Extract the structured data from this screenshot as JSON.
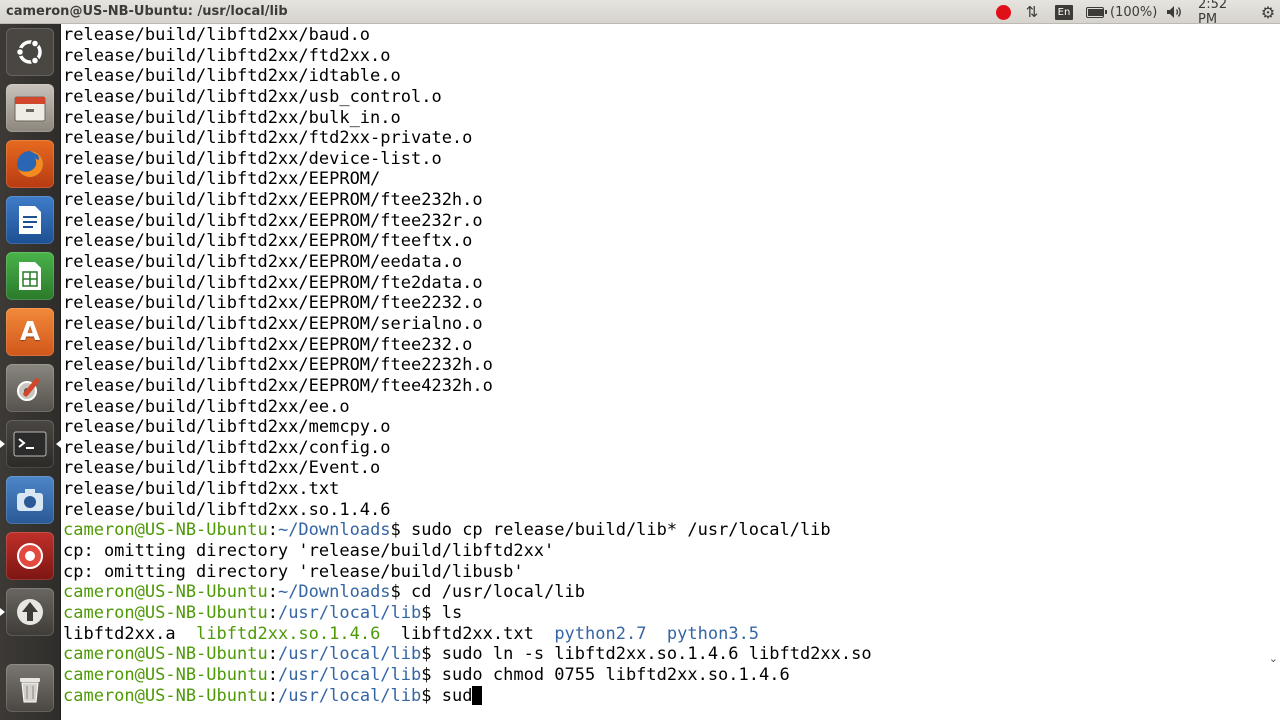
{
  "panel": {
    "window_title": "cameron@US-NB-Ubuntu: /usr/local/lib",
    "keyboard_layout": "En",
    "battery": {
      "text": "(100%)",
      "level": 1.0
    },
    "clock": "2:52 PM",
    "recording_color": "#e0101a",
    "icons": {
      "network": "network-updown-icon",
      "sound": "speaker-icon",
      "session": "gear-icon"
    }
  },
  "launcher": {
    "items": [
      {
        "name": "dash-home",
        "icon": "ubuntu-logo-icon",
        "active": false
      },
      {
        "name": "files",
        "icon": "file-cabinet-icon",
        "active": false
      },
      {
        "name": "firefox",
        "icon": "firefox-icon",
        "active": false
      },
      {
        "name": "writer",
        "icon": "libreoffice-writer-icon",
        "active": false
      },
      {
        "name": "calc",
        "icon": "libreoffice-calc-icon",
        "active": false
      },
      {
        "name": "software-center",
        "icon": "software-center-icon",
        "active": false
      },
      {
        "name": "system-settings",
        "icon": "settings-wrench-icon",
        "active": false
      },
      {
        "name": "terminal",
        "icon": "terminal-icon",
        "active": true
      },
      {
        "name": "screenshot-tool",
        "icon": "camera-icon",
        "active": false
      },
      {
        "name": "recorder",
        "icon": "record-icon",
        "active": false
      },
      {
        "name": "updater",
        "icon": "update-arrow-icon",
        "active": false
      },
      {
        "name": "trash",
        "icon": "trash-icon",
        "active": false
      }
    ]
  },
  "terminal": {
    "lines": [
      [
        {
          "t": "release/build/libftd2xx/baud.o"
        }
      ],
      [
        {
          "t": "release/build/libftd2xx/ftd2xx.o"
        }
      ],
      [
        {
          "t": "release/build/libftd2xx/idtable.o"
        }
      ],
      [
        {
          "t": "release/build/libftd2xx/usb_control.o"
        }
      ],
      [
        {
          "t": "release/build/libftd2xx/bulk_in.o"
        }
      ],
      [
        {
          "t": "release/build/libftd2xx/ftd2xx-private.o"
        }
      ],
      [
        {
          "t": "release/build/libftd2xx/device-list.o"
        }
      ],
      [
        {
          "t": "release/build/libftd2xx/EEPROM/"
        }
      ],
      [
        {
          "t": "release/build/libftd2xx/EEPROM/ftee232h.o"
        }
      ],
      [
        {
          "t": "release/build/libftd2xx/EEPROM/ftee232r.o"
        }
      ],
      [
        {
          "t": "release/build/libftd2xx/EEPROM/fteeftx.o"
        }
      ],
      [
        {
          "t": "release/build/libftd2xx/EEPROM/eedata.o"
        }
      ],
      [
        {
          "t": "release/build/libftd2xx/EEPROM/fte2data.o"
        }
      ],
      [
        {
          "t": "release/build/libftd2xx/EEPROM/ftee2232.o"
        }
      ],
      [
        {
          "t": "release/build/libftd2xx/EEPROM/serialno.o"
        }
      ],
      [
        {
          "t": "release/build/libftd2xx/EEPROM/ftee232.o"
        }
      ],
      [
        {
          "t": "release/build/libftd2xx/EEPROM/ftee2232h.o"
        }
      ],
      [
        {
          "t": "release/build/libftd2xx/EEPROM/ftee4232h.o"
        }
      ],
      [
        {
          "t": "release/build/libftd2xx/ee.o"
        }
      ],
      [
        {
          "t": "release/build/libftd2xx/memcpy.o"
        }
      ],
      [
        {
          "t": "release/build/libftd2xx/config.o"
        }
      ],
      [
        {
          "t": "release/build/libftd2xx/Event.o"
        }
      ],
      [
        {
          "t": "release/build/libftd2xx.txt"
        }
      ],
      [
        {
          "t": "release/build/libftd2xx.so.1.4.6"
        }
      ],
      [
        {
          "t": "cameron@US-NB-Ubuntu",
          "c": "p-user"
        },
        {
          "t": ":"
        },
        {
          "t": "~/Downloads",
          "c": "p-path"
        },
        {
          "t": "$ sudo cp release/build/lib* /usr/local/lib"
        }
      ],
      [
        {
          "t": "cp: omitting directory 'release/build/libftd2xx'"
        }
      ],
      [
        {
          "t": "cp: omitting directory 'release/build/libusb'"
        }
      ],
      [
        {
          "t": "cameron@US-NB-Ubuntu",
          "c": "p-user"
        },
        {
          "t": ":"
        },
        {
          "t": "~/Downloads",
          "c": "p-path"
        },
        {
          "t": "$ cd /usr/local/lib"
        }
      ],
      [
        {
          "t": "cameron@US-NB-Ubuntu",
          "c": "p-user"
        },
        {
          "t": ":"
        },
        {
          "t": "/usr/local/lib",
          "c": "p-path"
        },
        {
          "t": "$ ls"
        }
      ],
      [
        {
          "t": "libftd2xx.a"
        },
        {
          "t": "  "
        },
        {
          "t": "libftd2xx.so.1.4.6",
          "c": "ls-exec"
        },
        {
          "t": "  libftd2xx.txt  "
        },
        {
          "t": "python2.7",
          "c": "ls-dir"
        },
        {
          "t": "  "
        },
        {
          "t": "python3.5",
          "c": "ls-dir"
        }
      ],
      [
        {
          "t": "cameron@US-NB-Ubuntu",
          "c": "p-user"
        },
        {
          "t": ":"
        },
        {
          "t": "/usr/local/lib",
          "c": "p-path"
        },
        {
          "t": "$ sudo ln -s libftd2xx.so.1.4.6 libftd2xx.so"
        }
      ],
      [
        {
          "t": "cameron@US-NB-Ubuntu",
          "c": "p-user"
        },
        {
          "t": ":"
        },
        {
          "t": "/usr/local/lib",
          "c": "p-path"
        },
        {
          "t": "$ sudo chmod 0755 libftd2xx.so.1.4.6"
        }
      ],
      [
        {
          "t": "cameron@US-NB-Ubuntu",
          "c": "p-user"
        },
        {
          "t": ":"
        },
        {
          "t": "/usr/local/lib",
          "c": "p-path"
        },
        {
          "t": "$ sud"
        },
        {
          "cursor": true
        }
      ]
    ]
  }
}
